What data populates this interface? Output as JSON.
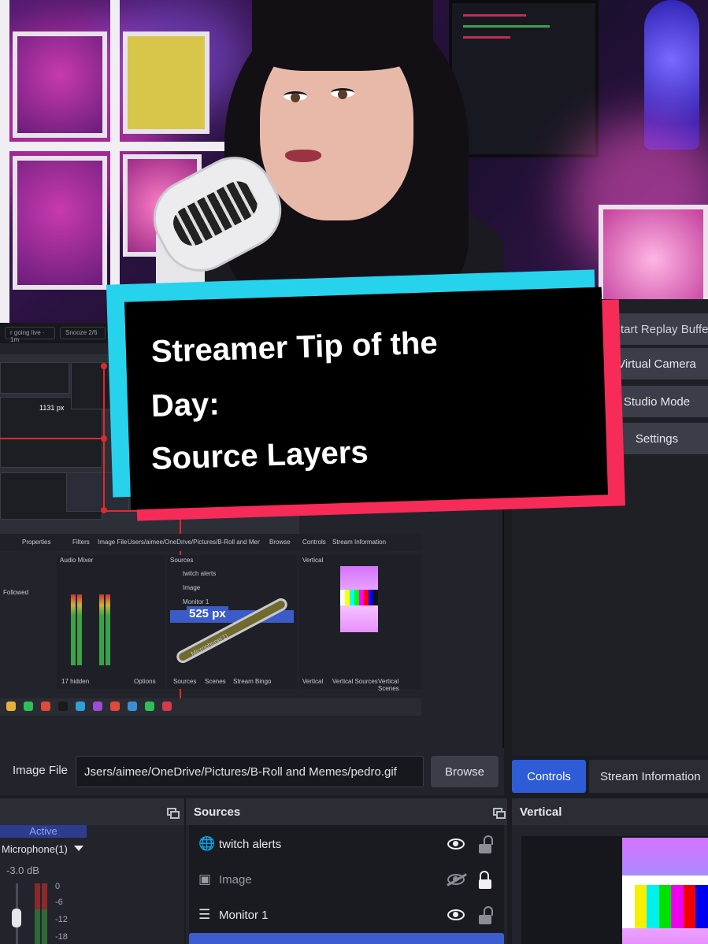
{
  "title_card": {
    "line1": "Streamer Tip of the",
    "line2": "Day:",
    "line3": "Source Layers"
  },
  "obs_controls": {
    "start_replay_label": "Start Replay Buffe",
    "virtual_camera_label": "Virtual Camera",
    "studio_mode_label": "Studio Mode",
    "settings_label": "Settings"
  },
  "inner_screenshot": {
    "going_live": "r going live · 1m",
    "snooze": "Snooze 2/6",
    "measure_1131": "1131 px",
    "measure_525": "525 px",
    "properties_label": "Properties",
    "filters_label": "Filters",
    "image_file_label": "Image File",
    "image_file_path": "Users/aimee/OneDrive/Pictures/B-Roll and Memes/pedro.gif",
    "browse_label": "Browse",
    "controls_tab": "Controls",
    "stream_info_tab": "Stream Information",
    "audio_mixer_title": "Audio Mixer",
    "sources_title": "Sources",
    "vertical_title": "Vertical",
    "sources": [
      "twitch alerts",
      "Image",
      "Monitor 1",
      "525 px",
      "Microphone(1)"
    ],
    "followed": "Followed",
    "hidden_count": "17 hidden",
    "options": "Options",
    "bottom_tabs": [
      "Sources",
      "Scenes",
      "Stream Bingo"
    ],
    "vertical_tabs": [
      "Vertical",
      "Vertical Sources",
      "Vertical Scenes"
    ]
  },
  "file_bar": {
    "label": "Image File",
    "path": "Jsers/aimee/OneDrive/Pictures/B-Roll and Memes/pedro.gif",
    "browse": "Browse"
  },
  "right_tabs": {
    "controls": "Controls",
    "stream_information": "Stream Information"
  },
  "mixer": {
    "active": "Active",
    "channel": "Microphone(1)",
    "db": "-3.0 dB",
    "ticks": [
      "0",
      "-6",
      "-12",
      "-18"
    ]
  },
  "sources": {
    "title": "Sources",
    "items": [
      {
        "label": "twitch alerts",
        "icon": "globe-icon",
        "visible": true,
        "locked": false
      },
      {
        "label": "Image",
        "icon": "image-icon",
        "visible": false,
        "locked": true
      },
      {
        "label": "Monitor 1",
        "icon": "list-icon",
        "visible": true,
        "locked": false
      }
    ]
  },
  "vertical": {
    "title": "Vertical"
  },
  "colors": {
    "card_cyan": "#27d2ec",
    "card_red": "#f62b58",
    "accent_blue": "#2e5bd6"
  }
}
